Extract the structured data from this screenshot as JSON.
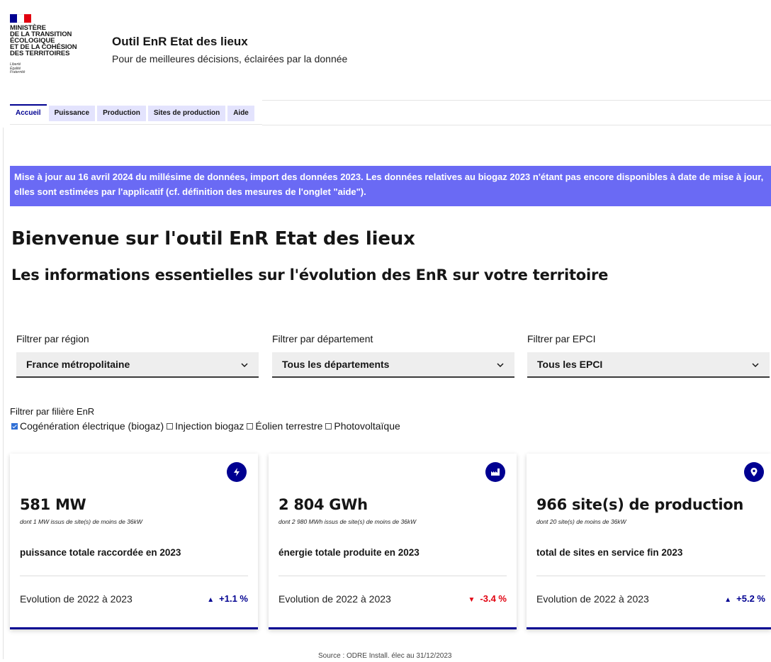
{
  "header": {
    "ministry_lines": [
      "MINISTÈRE",
      "DE LA TRANSITION",
      "ÉCOLOGIQUE",
      "ET DE LA COHÉSION",
      "DES TERRITOIRES"
    ],
    "motto_lines": [
      "Liberté",
      "Égalité",
      "Fraternité"
    ],
    "title": "Outil EnR Etat des lieux",
    "tagline": "Pour de meilleures décisions, éclairées par la donnée"
  },
  "tabs": [
    {
      "label": "Accueil",
      "active": true
    },
    {
      "label": "Puissance",
      "active": false
    },
    {
      "label": "Production",
      "active": false
    },
    {
      "label": "Sites de production",
      "active": false
    },
    {
      "label": "Aide",
      "active": false
    }
  ],
  "banner": {
    "text": "Mise à jour au 16 avril 2024 du millésime de données, import des données 2023. Les données relatives au biogaz 2023 n'étant pas encore disponibles à date de mise à jour, elles sont estimées par l'applicatif (cf. définition des mesures de l'onglet \"aide\")."
  },
  "main": {
    "title": "Bienvenue sur l'outil EnR Etat des lieux",
    "subtitle": "Les informations essentielles sur l'évolution des EnR sur votre territoire"
  },
  "filters": {
    "region": {
      "label": "Filtrer par région",
      "value": "France métropolitaine"
    },
    "departement": {
      "label": "Filtrer par département",
      "value": "Tous les départements"
    },
    "epci": {
      "label": "Filtrer par EPCI",
      "value": "Tous les EPCI"
    }
  },
  "enr_filter": {
    "label": "Filtrer par filière EnR",
    "options": [
      {
        "label": "Cogénération électrique (biogaz)",
        "checked": true
      },
      {
        "label": "Injection biogaz",
        "checked": false
      },
      {
        "label": "Éolien terrestre",
        "checked": false
      },
      {
        "label": "Photovoltaïque",
        "checked": false
      }
    ]
  },
  "cards": [
    {
      "icon": "lightning-icon",
      "value": "581 MW",
      "note": "dont 1 MW issus de site(s) de moins de 36kW",
      "description": "puissance totale raccordée en 2023",
      "evolution_label": "Evolution de 2022 à 2023",
      "evolution_value": "+1.1 %",
      "direction": "up"
    },
    {
      "icon": "factory-icon",
      "value": "2 804 GWh",
      "note": "dont 2 980 MWh issus de site(s) de moins de 36kW",
      "description": "énergie totale produite en 2023",
      "evolution_label": "Evolution de 2022 à 2023",
      "evolution_value": "-3.4 %",
      "direction": "down"
    },
    {
      "icon": "map-pin-icon",
      "value": "966 site(s) de production",
      "note": "dont 20 site(s) de moins de 36kW",
      "description": "total de sites en service fin 2023",
      "evolution_label": "Evolution de 2022 à 2023",
      "evolution_value": "+5.2 %",
      "direction": "up"
    }
  ],
  "colors": {
    "primary": "#000091",
    "banner": "#6a6af4",
    "negative": "#e1000f"
  },
  "footer": {
    "source": "Source : ODRE Install. élec au 31/12/2023"
  }
}
